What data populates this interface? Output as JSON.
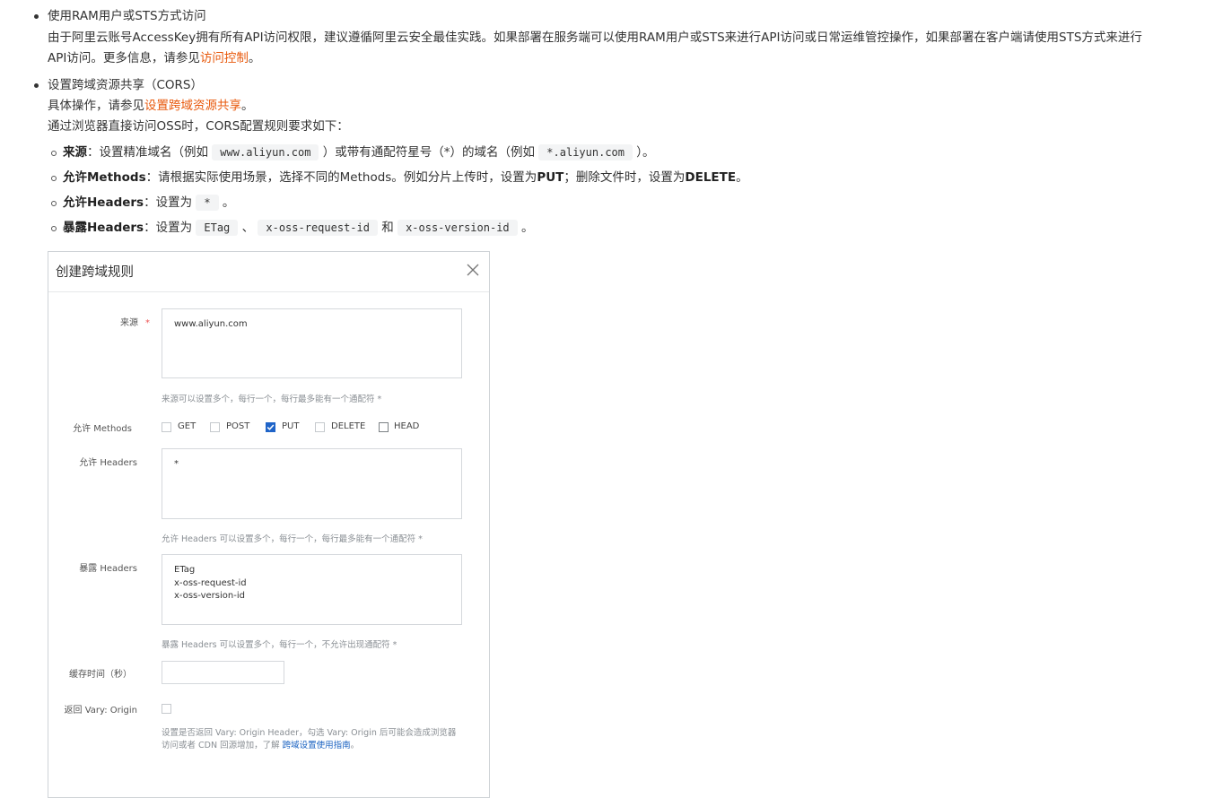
{
  "item1": {
    "title": "使用RAM用户或STS方式访问",
    "line1": "由于阿里云账号AccessKey拥有所有API访问权限，建议遵循阿里云安全最佳实践。如果部署在服务端可以使用RAM用户或STS来进行API访问或日常运维管控操作，如果部署在客户端请使用STS方式来进行",
    "line2_prefix": "API访问。更多信息，请参见",
    "line2_link": "访问控制",
    "line2_suffix": "。"
  },
  "item2": {
    "title": "设置跨域资源共享（CORS）",
    "line1_prefix": "具体操作，请参见",
    "line1_link": "设置跨域资源共享",
    "line1_suffix": "。",
    "line2": "通过浏览器直接访问OSS时，CORS配置规则要求如下：",
    "rules": [
      {
        "label": "来源",
        "t1": "：设置精准域名（例如",
        "c1": "www.aliyun.com",
        "t2": "）或带有通配符星号（*）的域名（例如",
        "c2": "*.aliyun.com",
        "t3": "）。"
      },
      {
        "label": "允许Methods",
        "t1": "：请根据实际使用场景，选择不同的Methods。例如分片上传时，设置为",
        "b1": "PUT",
        "t2": "；删除文件时，设置为",
        "b2": "DELETE",
        "t3": "。"
      },
      {
        "label": "允许Headers",
        "t1": "：设置为",
        "c1": "*",
        "t2": "。"
      },
      {
        "label": "暴露Headers",
        "t1": "：设置为",
        "c1": "ETag",
        "t2": "、",
        "c2": "x-oss-request-id",
        "t3": "和",
        "c3": "x-oss-version-id",
        "t4": "。"
      }
    ]
  },
  "dialog": {
    "title": "创建跨域规则",
    "origin_label": "来源",
    "required_mark": "*",
    "origin_value": "www.aliyun.com",
    "origin_hint": "来源可以设置多个，每行一个，每行最多能有一个通配符 *",
    "methods_label": "允许 Methods",
    "methods": [
      {
        "label": "GET",
        "checked": false
      },
      {
        "label": "POST",
        "checked": false
      },
      {
        "label": "PUT",
        "checked": true
      },
      {
        "label": "DELETE",
        "checked": false
      },
      {
        "label": "HEAD",
        "checked": false
      }
    ],
    "allow_headers_label": "允许 Headers",
    "allow_headers_value": "*",
    "allow_headers_hint": "允许 Headers 可以设置多个，每行一个，每行最多能有一个通配符 *",
    "expose_headers_label": "暴露 Headers",
    "expose_headers_value": "ETag\nx-oss-request-id\nx-oss-version-id",
    "expose_headers_hint": "暴露 Headers 可以设置多个，每行一个，不允许出现通配符 *",
    "cache_label": "缓存时间（秒）",
    "cache_value": "",
    "vary_label": "返回 Vary: Origin",
    "vary_checked": false,
    "vary_hint1": "设置是否返回 Vary: Origin Header，勾选 Vary: Origin 后可能会造成浏览器",
    "vary_hint2_prefix": "访问或者 CDN 回源增加，了解",
    "vary_hint2_link": "跨域设置使用指南",
    "vary_hint2_suffix": "。"
  }
}
